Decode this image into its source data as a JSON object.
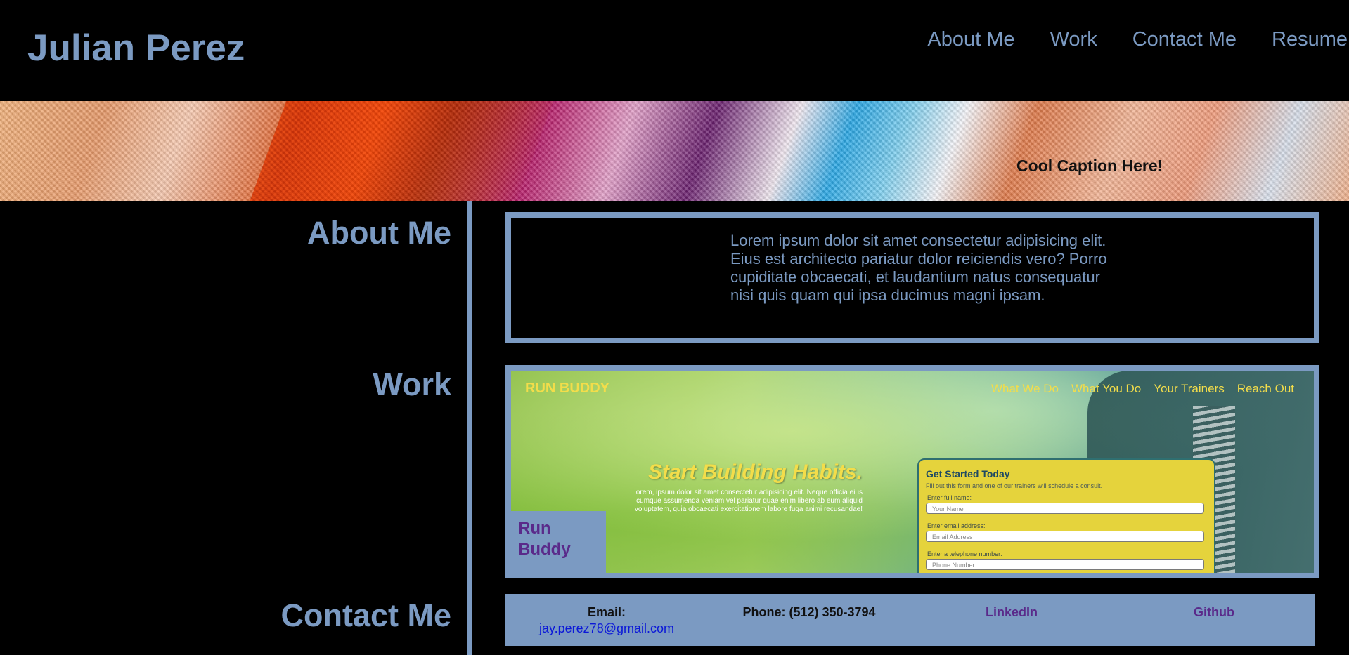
{
  "header": {
    "title": "Julian Perez",
    "nav": [
      "About Me",
      "Work",
      "Contact Me",
      "Resume"
    ]
  },
  "hero": {
    "caption": "Cool Caption Here!"
  },
  "about": {
    "heading": "About Me",
    "text": "Lorem ipsum dolor sit amet consectetur adipisicing elit. Eius est architecto pariatur dolor reiciendis vero? Porro cupiditate obcaecati, et laudantium natus consequatur nisi quis quam qui ipsa ducimus magni ipsam."
  },
  "work": {
    "heading": "Work",
    "project_label": "Run Buddy",
    "preview": {
      "brand": "RUN BUDDY",
      "nav": [
        "What We Do",
        "What You Do",
        "Your Trainers",
        "Reach Out"
      ],
      "headline": "Start Building Habits.",
      "subtext": "Lorem, ipsum dolor sit amet consectetur adipisicing elit. Neque officia eius cumque assumenda veniam vel pariatur quae enim libero ab eum aliquid voluptatem, quia obcaecati exercitationem labore fuga animi recusandae!",
      "form": {
        "title": "Get Started Today",
        "description": "Fill out this form and one of our trainers will schedule a consult.",
        "fields": [
          {
            "label": "Enter full name:",
            "placeholder": "Your Name"
          },
          {
            "label": "Enter email address:",
            "placeholder": "Email Address"
          },
          {
            "label": "Enter a telephone number:",
            "placeholder": "Phone Number"
          }
        ]
      }
    }
  },
  "contact": {
    "heading": "Contact Me",
    "email_label": "Email:",
    "email": "jay.perez78@gmail.com",
    "phone": "Phone: (512) 350-3794",
    "linkedin": "LinkedIn",
    "github": "Github"
  },
  "colors": {
    "accent": "#7b9ac2",
    "background": "#000000",
    "link": "#0b18d8",
    "visited": "#5a2a8a"
  }
}
